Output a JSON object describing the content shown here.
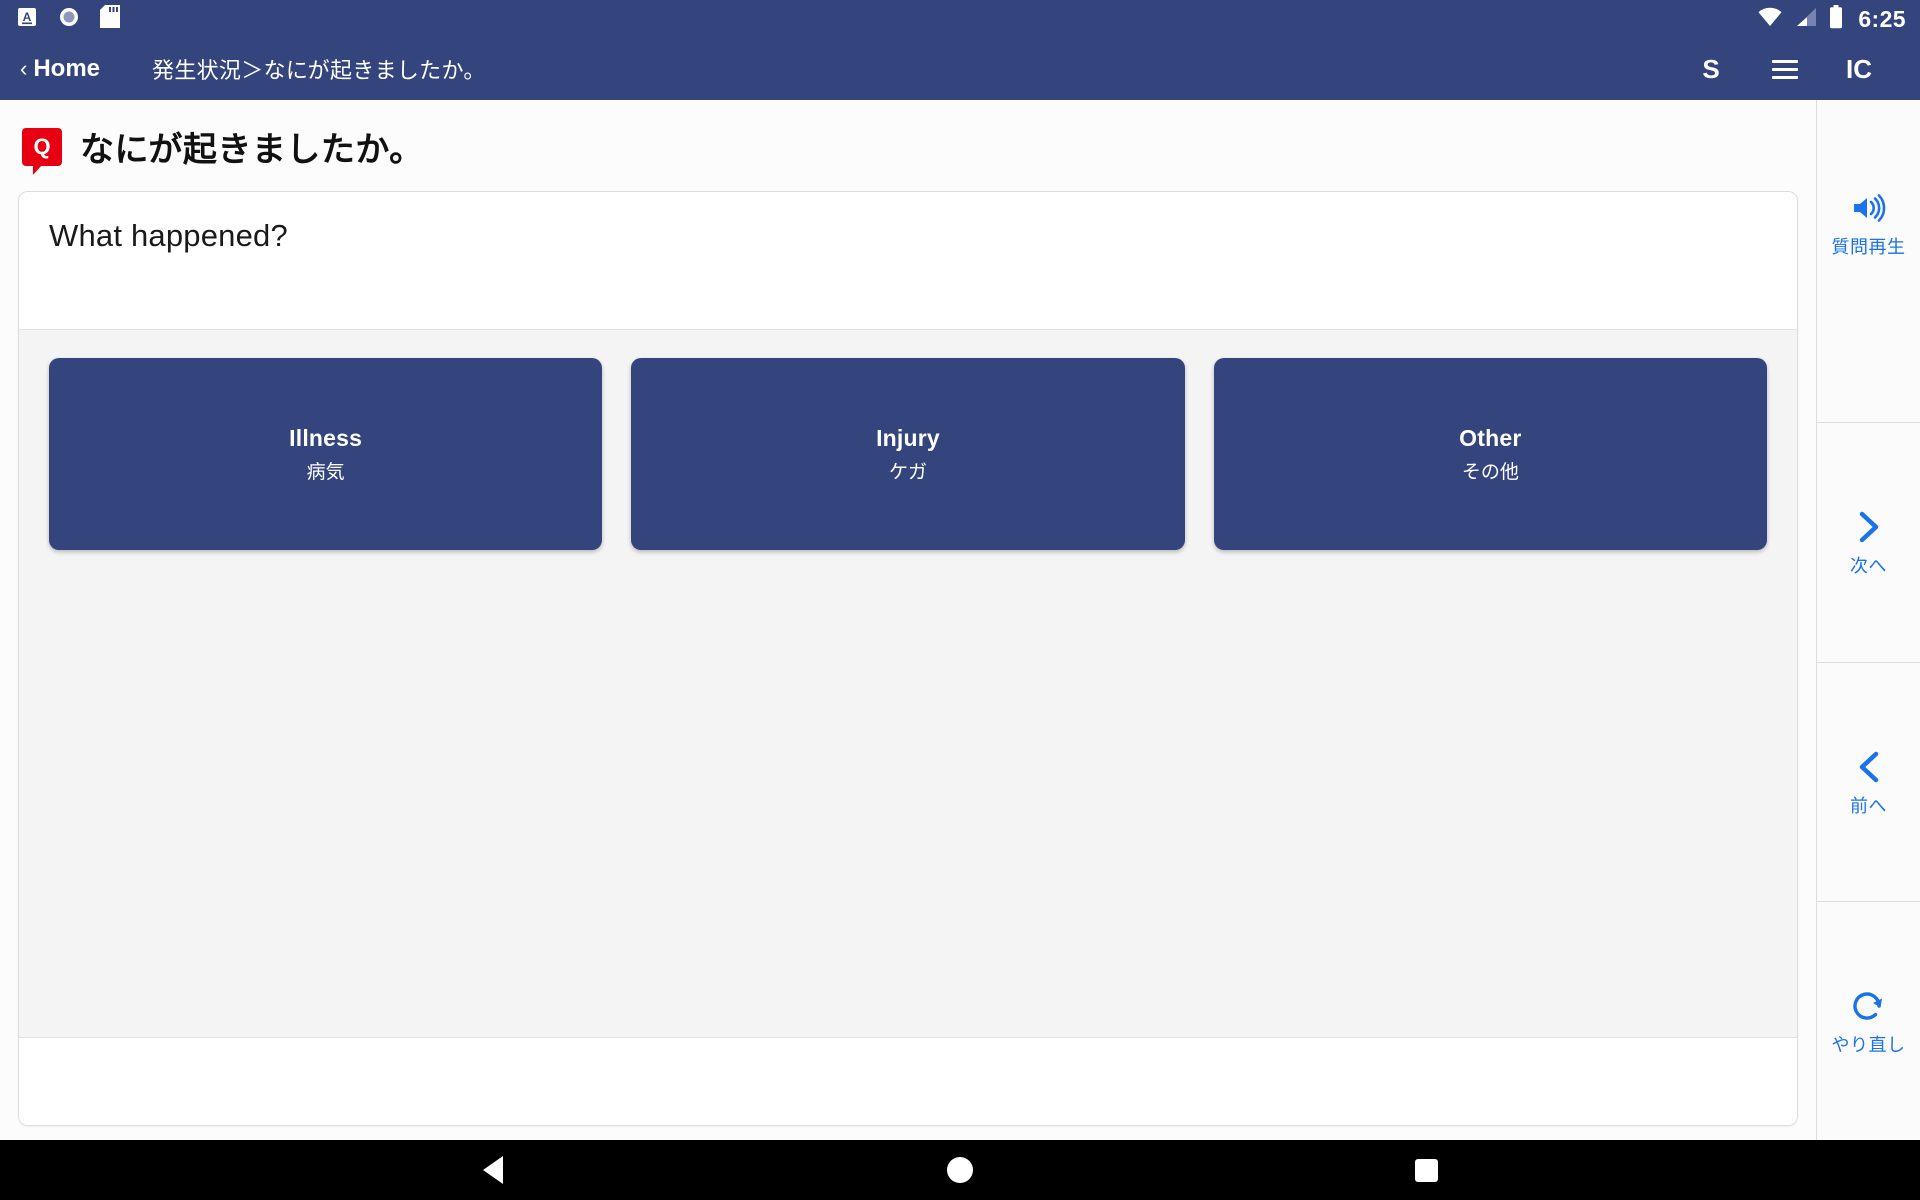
{
  "status_bar": {
    "icons": [
      "input-method-icon",
      "record-dot-icon",
      "sd-card-icon",
      "wifi-icon",
      "signal-icon",
      "battery-icon"
    ],
    "time": "6:25"
  },
  "app_bar": {
    "home_chevron": "‹",
    "home_label": "Home",
    "breadcrumb": "発生状況＞なにが起きましたか。",
    "right_items": [
      {
        "label": "S",
        "name": "s-button"
      },
      {
        "label": "IC",
        "name": "ic-button"
      }
    ],
    "menu_icon": "hamburger-menu-icon"
  },
  "question": {
    "badge_letter": "Q",
    "title": "なにが起きましたか。"
  },
  "card": {
    "header_text": "What happened?",
    "options": [
      {
        "en": "Illness",
        "ja": "病気"
      },
      {
        "en": "Injury",
        "ja": "ケガ"
      },
      {
        "en": "Other",
        "ja": "その他"
      }
    ]
  },
  "sidebar": {
    "items": [
      {
        "label": "質問再生",
        "icon": "speaker-volume-icon"
      },
      {
        "label": "次へ",
        "icon": "chevron-right-icon"
      },
      {
        "label": "前へ",
        "icon": "chevron-left-icon"
      },
      {
        "label": "やり直し",
        "icon": "redo-arrow-icon"
      }
    ]
  },
  "nav_bar": {
    "back": "back-triangle-icon",
    "home": "home-circle-icon",
    "recent": "recent-square-icon"
  },
  "colors": {
    "brand_navy": "#34447d",
    "accent_blue": "#1a73e8",
    "badge_red": "#e60012"
  }
}
